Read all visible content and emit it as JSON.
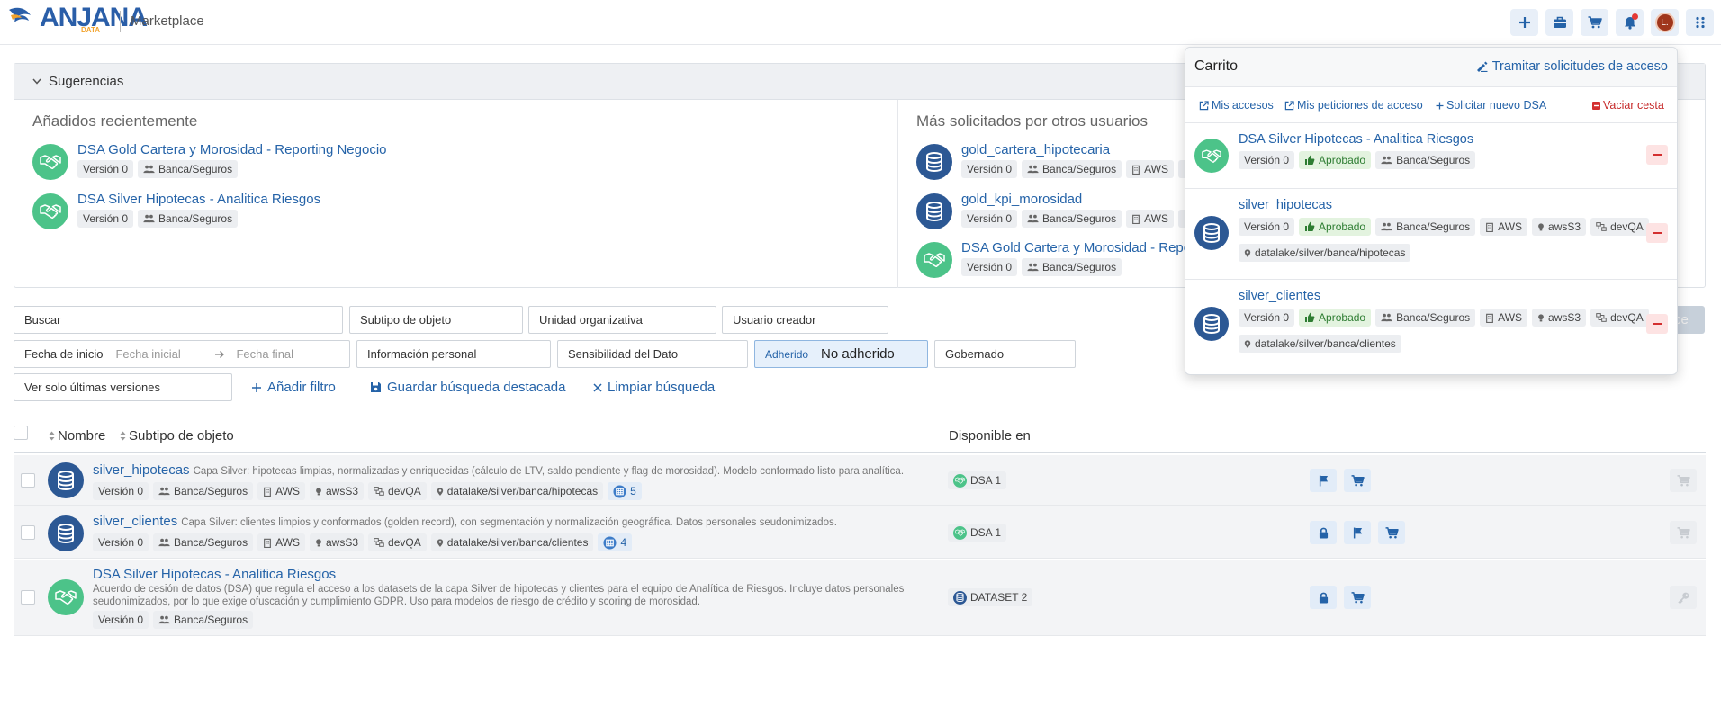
{
  "header": {
    "logo_text": "ANJANA",
    "logo_sub": "DATA",
    "app_title": "Marketplace",
    "avatar_initial": "L."
  },
  "suggestions": {
    "title": "Sugerencias",
    "recent": {
      "title": "Añadidos recientemente",
      "items": [
        {
          "name": "DSA Gold Cartera y Morosidad - Reporting Negocio",
          "version": "Versión 0",
          "org": "Banca/Seguros"
        },
        {
          "name": "DSA Silver Hipotecas - Analitica Riesgos",
          "version": "Versión 0",
          "org": "Banca/Seguros"
        }
      ]
    },
    "popular": {
      "title": "Más solicitados por otros usuarios",
      "items": [
        {
          "name": "gold_cartera_hipotecaria",
          "version": "Versión 0",
          "org": "Banca/Seguros",
          "cloud": "AWS"
        },
        {
          "name": "gold_kpi_morosidad",
          "version": "Versión 0",
          "org": "Banca/Seguros",
          "cloud": "AWS"
        },
        {
          "name": "DSA Gold Cartera y Morosidad - Repo",
          "version": "Versión 0",
          "org": "Banca/Seguros"
        }
      ]
    }
  },
  "filters": {
    "search": "Buscar",
    "subtype": "Subtipo de objeto",
    "org_unit": "Unidad organizativa",
    "creator": "Usuario creador",
    "start_date": "Fecha de inicio",
    "date_from_ph": "Fecha inicial",
    "date_to_ph": "Fecha final",
    "personal_info": "Información personal",
    "sensitivity": "Sensibilidad del Dato",
    "adhered_label": "Adherido",
    "adhered_value": "No adherido",
    "governed": "Gobernado",
    "latest_versions": "Ver solo últimas versiones",
    "add_filter": "Añadir filtro",
    "save_search": "Guardar búsqueda destacada",
    "clear_search": "Limpiar búsqueda",
    "ghost_btn": "ce"
  },
  "table": {
    "col_name": "Nombre",
    "col_subtype": "Subtipo de objeto",
    "col_available": "Disponible en",
    "rows": [
      {
        "name": "silver_hipotecas",
        "desc": "Capa Silver: hipotecas limpias, normalizadas y enriquecidas (cálculo de LTV, saldo pendiente y flag de morosidad). Modelo conformado listo para analítica.",
        "version": "Versión 0",
        "org": "Banca/Seguros",
        "cloud": "AWS",
        "store": "awsS3",
        "env": "devQA",
        "path": "datalake/silver/banca/hipotecas",
        "count": "5",
        "available": "DSA 1"
      },
      {
        "name": "silver_clientes",
        "desc": "Capa Silver: clientes limpios y conformados (golden record), con segmentación y normalización geográfica. Datos personales seudonimizados.",
        "version": "Versión 0",
        "org": "Banca/Seguros",
        "cloud": "AWS",
        "store": "awsS3",
        "env": "devQA",
        "path": "datalake/silver/banca/clientes",
        "count": "4",
        "available": "DSA 1"
      },
      {
        "name": "DSA Silver Hipotecas - Analitica Riesgos",
        "desc": "Acuerdo de cesión de datos (DSA) que regula el acceso a los datasets de la capa Silver de hipotecas y clientes para el equipo de Analítica de Riesgos. Incluye datos personales seudonimizados, por lo que exige ofuscación y cumplimiento GDPR. Uso para modelos de riesgo de crédito y scoring de morosidad.",
        "version": "Versión 0",
        "org": "Banca/Seguros",
        "available": "DATASET 2"
      }
    ]
  },
  "cart": {
    "title": "Carrito",
    "process": "Tramitar solicitudes de acceso",
    "links": {
      "my_access": "Mis accesos",
      "my_requests": "Mis peticiones de acceso",
      "new_dsa": "Solicitar nuevo DSA",
      "empty": "Vaciar cesta"
    },
    "items": [
      {
        "name": "DSA Silver Hipotecas - Analitica Riesgos",
        "version": "Versión 0",
        "status": "Aprobado",
        "org": "Banca/Seguros"
      },
      {
        "name": "silver_hipotecas",
        "version": "Versión 0",
        "status": "Aprobado",
        "org": "Banca/Seguros",
        "cloud": "AWS",
        "store": "awsS3",
        "env": "devQA",
        "path": "datalake/silver/banca/hipotecas"
      },
      {
        "name": "silver_clientes",
        "version": "Versión 0",
        "status": "Aprobado",
        "org": "Banca/Seguros",
        "cloud": "AWS",
        "store": "awsS3",
        "env": "devQA",
        "path": "datalake/silver/banca/clientes"
      }
    ]
  },
  "colors": {
    "primary": "#2563a8",
    "dsa_green": "#4cc389",
    "dataset_navy": "#2c5894",
    "danger": "#d32f2f",
    "approved": "#2e7d32"
  },
  "icons": [
    "plus-icon",
    "briefcase-icon",
    "cart-icon",
    "bell-icon",
    "grid-icon",
    "handshake-icon",
    "database-icon",
    "users-icon",
    "building-icon",
    "pin-icon",
    "network-icon",
    "table-icon",
    "flag-icon",
    "lock-icon",
    "key-icon",
    "thumbs-up-icon",
    "external-link-icon",
    "chevron-down-icon",
    "arrow-right-icon",
    "save-icon",
    "close-icon",
    "sort-icon"
  ]
}
